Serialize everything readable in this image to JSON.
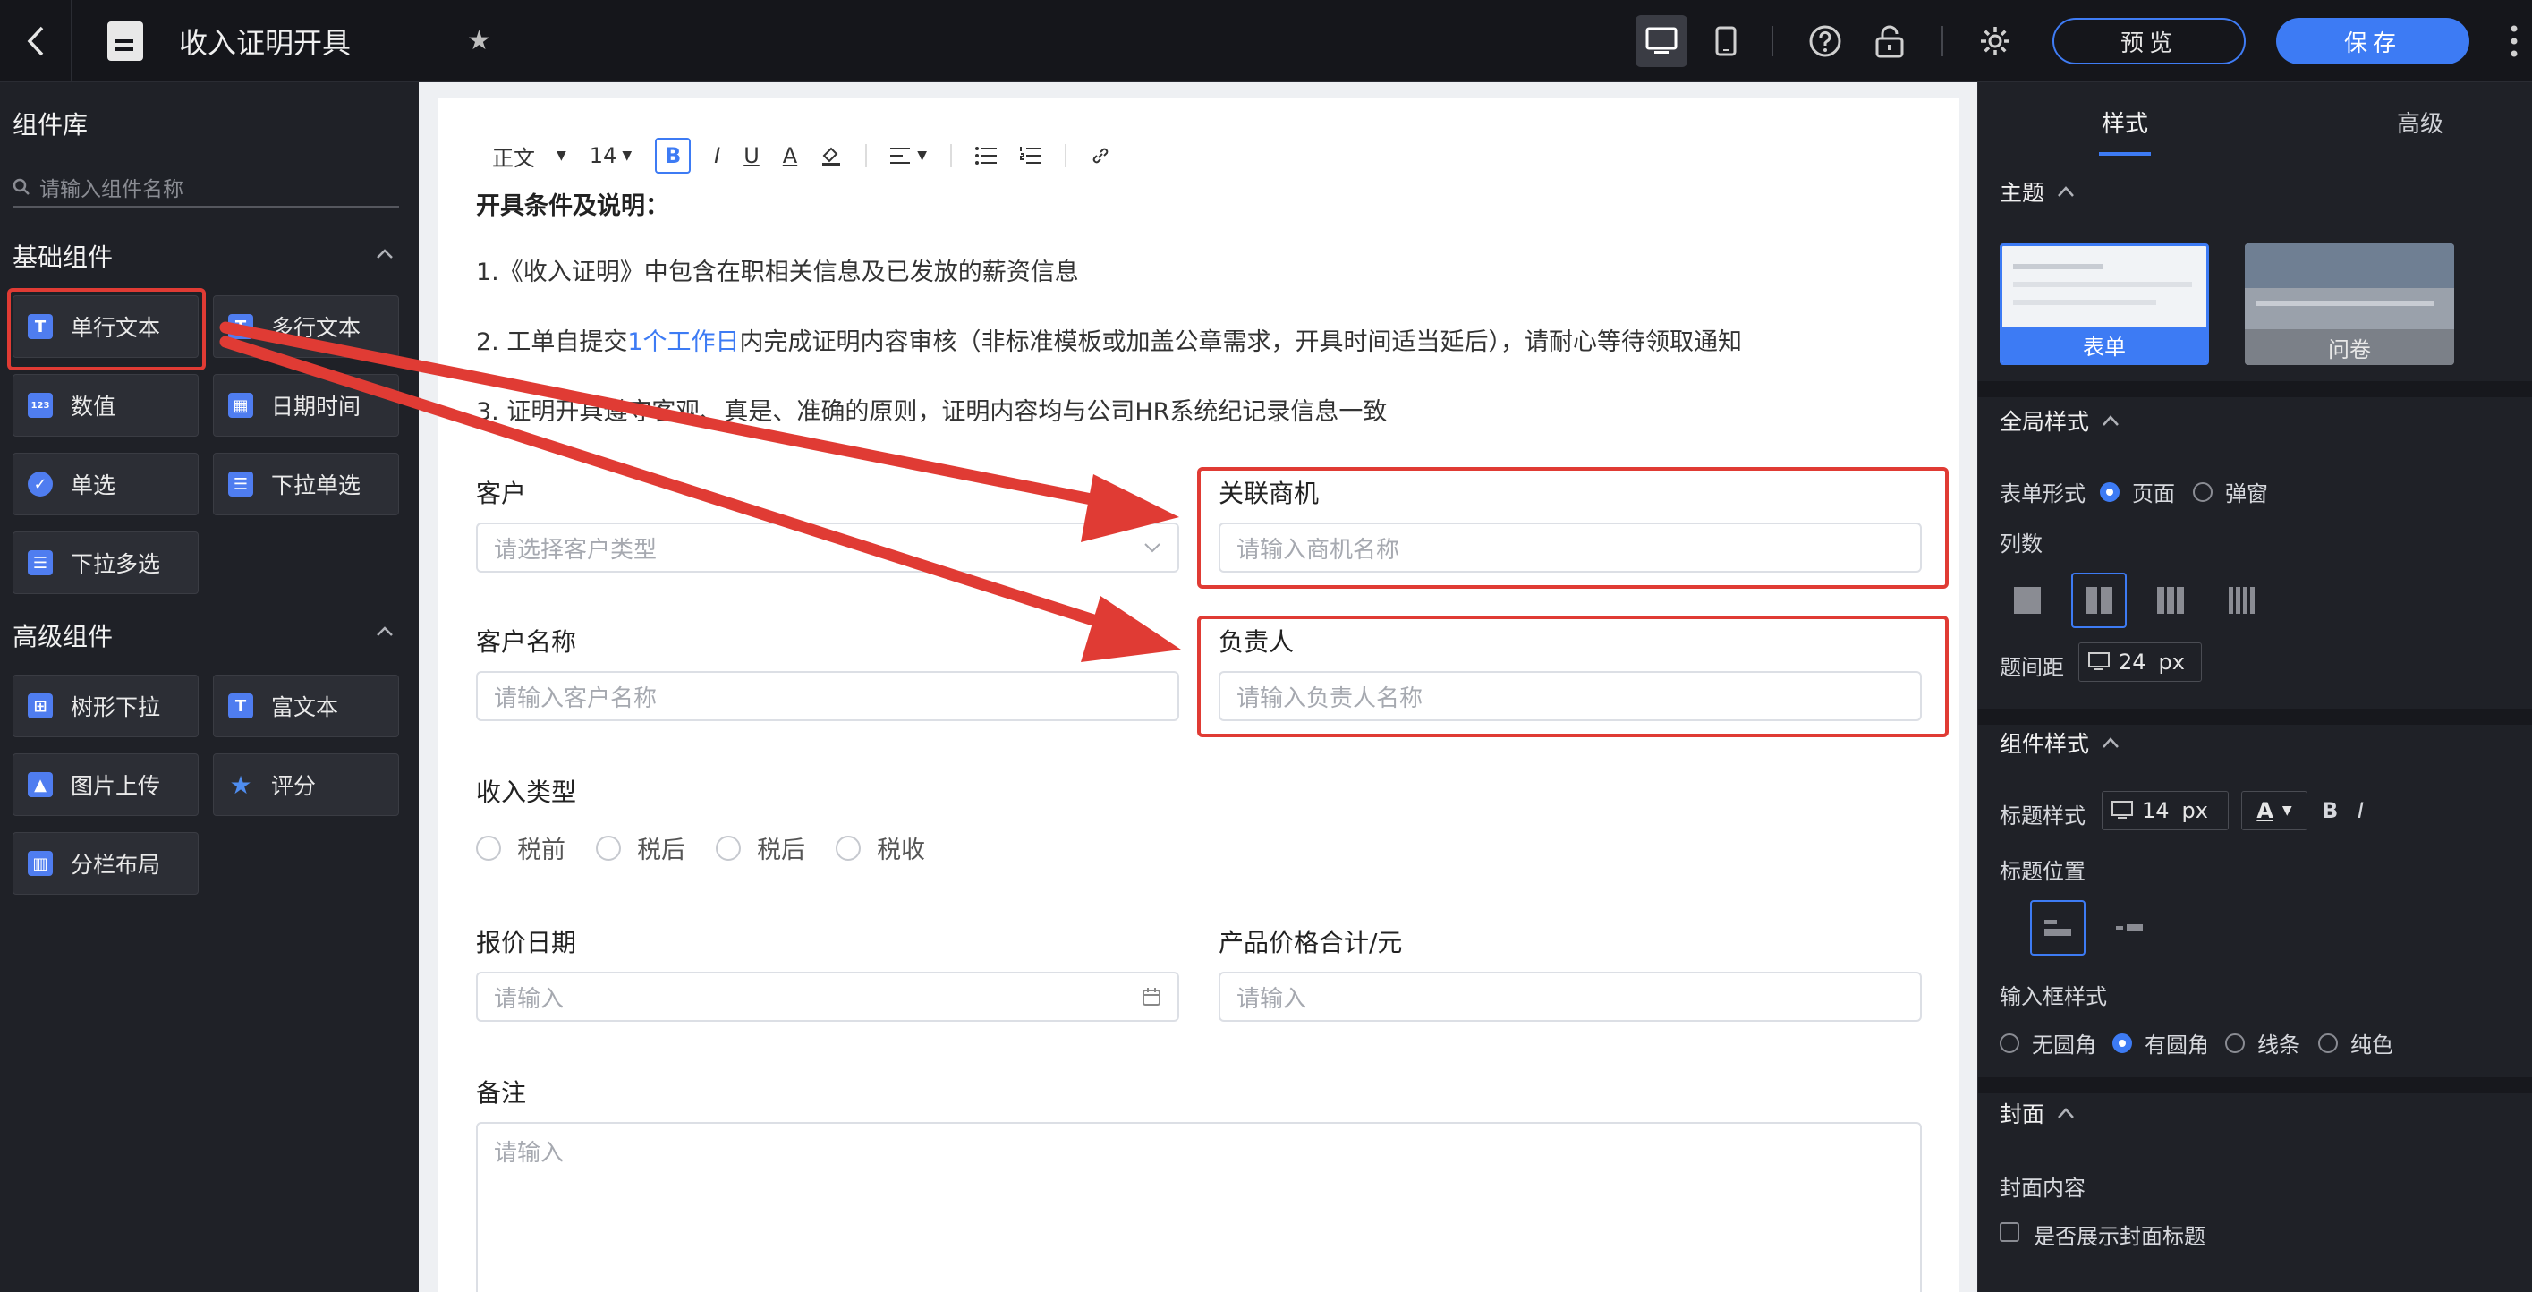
{
  "header": {
    "title": "收入证明开具",
    "preview_label": "预览",
    "save_label": "保存"
  },
  "library": {
    "title": "组件库",
    "search_placeholder": "请输入组件名称",
    "basic_title": "基础组件",
    "advanced_title": "高级组件",
    "basic_items": [
      "单行文本",
      "多行文本",
      "数值",
      "日期时间",
      "单选",
      "下拉单选",
      "下拉多选"
    ],
    "advanced_items": [
      "树形下拉",
      "富文本",
      "图片上传",
      "评分",
      "分栏布局"
    ],
    "number_icon_text": "123"
  },
  "editor": {
    "style_label": "正文",
    "size_label": "14",
    "bold_label": "B",
    "italic_label": "I",
    "underline_label": "U",
    "color_label": "A"
  },
  "form": {
    "desc_title": "开具条件及说明：",
    "desc_1": "1.《收入证明》中包含在职相关信息及已发放的薪资信息",
    "desc_2_pre": "2. 工单自提交",
    "desc_2_link": "1个工作日",
    "desc_2_post": "内完成证明内容审核（非标准模板或加盖公章需求，开具时间适当延后），请耐心等待领取通知",
    "desc_3": "3. 证明开具遵守客观、真是、准确的原则，证明内容均与公司HR系统纪记录信息一致",
    "customer_label": "客户",
    "customer_ph": "请选择客户类型",
    "opportunity_label": "关联商机",
    "opportunity_ph": "请输入商机名称",
    "customer_name_label": "客户名称",
    "customer_name_ph": "请输入客户名称",
    "owner_label": "负责人",
    "owner_ph": "请输入负责人名称",
    "income_type_label": "收入类型",
    "income_options": [
      "税前",
      "税后",
      "税后",
      "税收"
    ],
    "quote_date_label": "报价日期",
    "quote_date_ph": "请输入",
    "price_total_label": "产品价格合计/元",
    "price_total_ph": "请输入",
    "remark_label": "备注",
    "remark_ph": "请输入"
  },
  "panel": {
    "tab_style": "样式",
    "tab_advanced": "高级",
    "theme_title": "主题",
    "theme_form": "表单",
    "theme_survey": "问卷",
    "global_title": "全局样式",
    "form_mode_label": "表单形式",
    "mode_page": "页面",
    "mode_popup": "弹窗",
    "columns_label": "列数",
    "spacing_label": "题间距",
    "spacing_value": "24",
    "spacing_unit": "px",
    "component_title": "组件样式",
    "title_style_label": "标题样式",
    "title_size_value": "14",
    "title_size_unit": "px",
    "color_letter": "A",
    "bold_letter": "B",
    "italic_letter": "I",
    "title_pos_label": "标题位置",
    "input_style_label": "输入框样式",
    "input_styles": [
      "无圆角",
      "有圆角",
      "线条",
      "纯色"
    ],
    "cover_title": "封面",
    "cover_content_label": "封面内容",
    "cover_show_title": "是否展示封面标题"
  },
  "colors": {
    "accent": "#3d7bf4",
    "highlight": "#e03b34"
  }
}
